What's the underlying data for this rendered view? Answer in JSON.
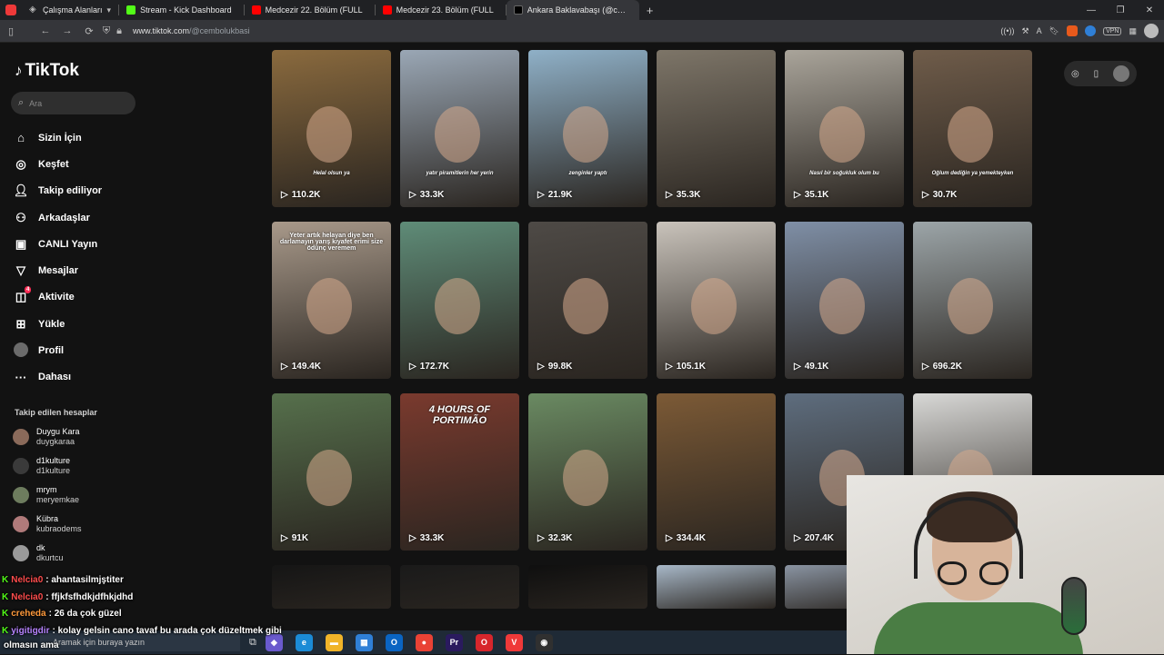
{
  "browser": {
    "tabs": [
      {
        "label": "Çalışma Alanları",
        "icon": "workspaces-icon",
        "kind": "ws"
      },
      {
        "label": "Stream - Kick Dashboard",
        "icon": "kick-icon",
        "kind": "kick"
      },
      {
        "label": "Medcezir 22. Bölüm (FULL",
        "icon": "youtube-icon",
        "kind": "yt"
      },
      {
        "label": "Medcezir 23. Bölüm (FULL",
        "icon": "youtube-icon",
        "kind": "yt"
      },
      {
        "label": "Ankara Baklavabaşı (@cem",
        "icon": "tiktok-icon",
        "kind": "tt",
        "active": true
      }
    ],
    "url_host": "www.tiktok.com",
    "url_path": "/@cembolukbasi",
    "vpn_label": "VPN"
  },
  "tiktok": {
    "logo_text": "TikTok",
    "search_placeholder": "Ara",
    "nav": [
      {
        "label": "Sizin İçin",
        "icon": "home-icon"
      },
      {
        "label": "Keşfet",
        "icon": "compass-icon"
      },
      {
        "label": "Takip ediliyor",
        "icon": "following-icon"
      },
      {
        "label": "Arkadaşlar",
        "icon": "friends-icon"
      },
      {
        "label": "CANLI Yayın",
        "icon": "live-icon"
      },
      {
        "label": "Mesajlar",
        "icon": "messages-icon"
      },
      {
        "label": "Aktivite",
        "icon": "activity-icon",
        "badge": "4"
      },
      {
        "label": "Yükle",
        "icon": "upload-icon"
      },
      {
        "label": "Profil",
        "icon": "profile-avatar"
      },
      {
        "label": "Dahası",
        "icon": "more-icon"
      }
    ],
    "following_header": "Takip edilen hesaplar",
    "following": [
      {
        "name": "Duygu Kara",
        "handle": "duygkaraa"
      },
      {
        "name": "d1kulture",
        "handle": "d1kulture"
      },
      {
        "name": "mrym",
        "handle": "meryemkae"
      },
      {
        "name": "Kübra",
        "handle": "kubraodems"
      },
      {
        "name": "dk",
        "handle": "dkurtcu"
      }
    ],
    "videos": [
      {
        "views": "110.2K",
        "caption": "Helal olsun ya",
        "bg": "#8a6a3e"
      },
      {
        "views": "33.3K",
        "caption": "yatır piramitlerin her yerin",
        "bg": "#9aa7b5"
      },
      {
        "views": "21.9K",
        "caption": "zenginler yaptı",
        "bg": "#8fb0c7"
      },
      {
        "views": "35.3K",
        "caption": "",
        "bg": "#7d7568"
      },
      {
        "views": "35.1K",
        "caption": "Nasıl bir soğukluk olum bu",
        "bg": "#a9a49a"
      },
      {
        "views": "30.7K",
        "caption": "Oğlum dediğin ya yemekteyken",
        "bg": "#6f5c4a"
      },
      {
        "views": "149.4K",
        "caption": "Yeter artık helayan diye ben darlamayın yarış kıyafet erimi size ödünç veremem",
        "bg": "#a8998a"
      },
      {
        "views": "172.7K",
        "caption": "",
        "bg": "#5f8c78"
      },
      {
        "views": "99.8K",
        "caption": "",
        "bg": "#4e4a46"
      },
      {
        "views": "105.1K",
        "caption": "",
        "bg": "#c9c3bb"
      },
      {
        "views": "49.1K",
        "caption": "",
        "bg": "#7f8fa6"
      },
      {
        "views": "696.2K",
        "caption": "",
        "bg": "#9ca5a8"
      },
      {
        "views": "91K",
        "caption": "",
        "bg": "#56704c"
      },
      {
        "views": "33.3K",
        "caption": "",
        "bg": "#7a3a2e"
      },
      {
        "views": "32.3K",
        "caption": "",
        "bg": "#6a8a62"
      },
      {
        "views": "334.4K",
        "caption": "",
        "bg": "#7c5a36"
      },
      {
        "views": "207.4K",
        "caption": "",
        "bg": "#5e6d7e"
      },
      {
        "views": "",
        "caption": "",
        "bg": "#d8d8d6"
      },
      {
        "views": "",
        "caption": "",
        "bg": "#151515"
      },
      {
        "views": "",
        "caption": "",
        "bg": "#1a1a1a"
      },
      {
        "views": "",
        "caption": "",
        "bg": "#0f0f0f"
      },
      {
        "views": "",
        "caption": "",
        "bg": "#a8b8c8"
      },
      {
        "views": "",
        "caption": "",
        "bg": "#8a94a2"
      }
    ],
    "poster_text": "4 HOURS OF PORTIMÃO"
  },
  "chat": [
    {
      "user": "Nelcia0",
      "msg": ": ahantasilmjştiter",
      "color": "red"
    },
    {
      "user": "Nelcia0",
      "msg": ": ffjkfsfhdkjdfhkjdhd",
      "color": "red"
    },
    {
      "user": "crehedа",
      "msg": ": 26 da çok güzel",
      "color": "orange"
    },
    {
      "user": "yigitigdir",
      "msg": ": kolay gelsin cano tavaf bu arada çok düzeltmek gibi",
      "color": "purple"
    }
  ],
  "chat_overflow": "olmasın ama",
  "taskbar": {
    "search_placeholder": "Aramak için buraya yazın",
    "apps": [
      {
        "name": "copilot-icon",
        "color": "#6a5acd",
        "glyph": "◆"
      },
      {
        "name": "edge-icon",
        "color": "#1b8bd6",
        "glyph": "e"
      },
      {
        "name": "explorer-icon",
        "color": "#f0b429",
        "glyph": "▬"
      },
      {
        "name": "store-icon",
        "color": "#2f7fd6",
        "glyph": "▦"
      },
      {
        "name": "outlook-icon",
        "color": "#0a64c2",
        "glyph": "O"
      },
      {
        "name": "chrome-icon",
        "color": "#e94235",
        "glyph": "●"
      },
      {
        "name": "premiere-icon",
        "color": "#2a1a5e",
        "glyph": "Pr"
      },
      {
        "name": "opera-icon",
        "color": "#d7262c",
        "glyph": "O"
      },
      {
        "name": "vivaldi-icon",
        "color": "#ef3939",
        "glyph": "V"
      },
      {
        "name": "obs-icon",
        "color": "#303030",
        "glyph": "◉"
      }
    ]
  }
}
